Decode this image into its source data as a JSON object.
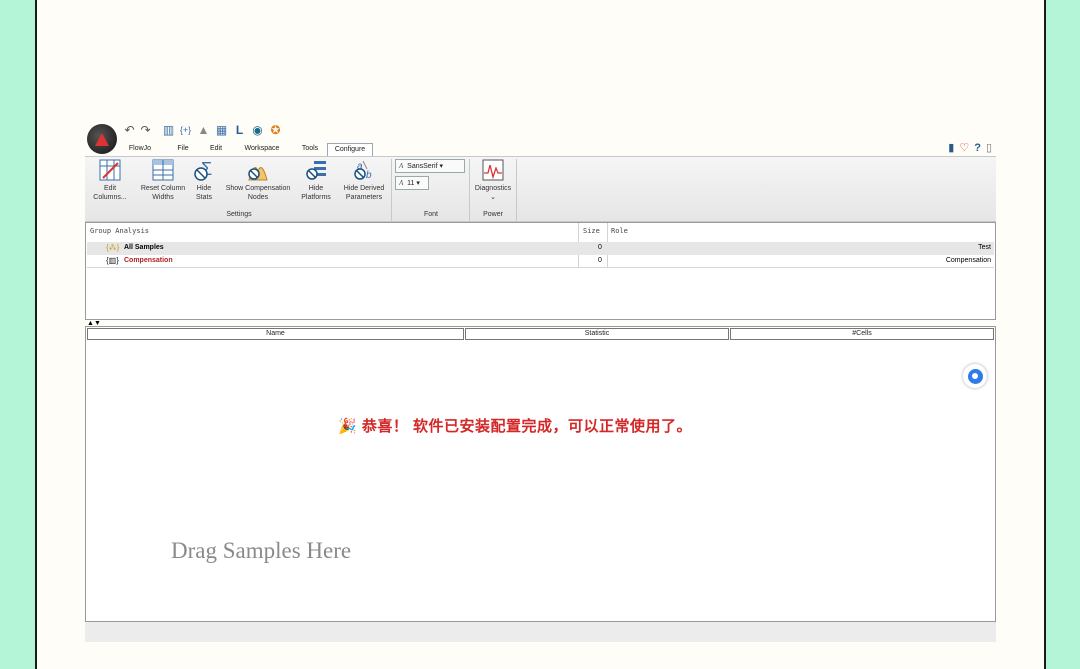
{
  "menu": {
    "tabs": [
      "FlowJo",
      "File",
      "Edit",
      "Workspace",
      "Tools",
      "Configure"
    ],
    "active": "Configure"
  },
  "ribbon": {
    "settings_buttons": [
      {
        "label": "Edit Columns...",
        "line1": "Edit",
        "line2": "Columns..."
      },
      {
        "label": "Reset Column Widths",
        "line1": "Reset Column",
        "line2": "Widths"
      },
      {
        "label": "Hide Stats",
        "line1": "Hide",
        "line2": "Stats"
      },
      {
        "label": "Show Compensation Nodes",
        "line1": "Show Compensation",
        "line2": "Nodes"
      },
      {
        "label": "Hide Platforms",
        "line1": "Hide",
        "line2": "Platforms"
      },
      {
        "label": "Hide Derived Parameters",
        "line1": "Hide Derived",
        "line2": "Parameters"
      }
    ],
    "settings_group": "Settings",
    "font_name": "SansSerif",
    "font_size": "11",
    "font_group": "Font",
    "diagnostics": "Diagnostics",
    "power_group": "Power"
  },
  "group_pane": {
    "headers": {
      "name": "Group Analysis",
      "size": "Size",
      "role": "Role"
    },
    "rows": [
      {
        "name": "All Samples",
        "size": "0",
        "role": "Test"
      },
      {
        "name": "Compensation",
        "size": "0",
        "role": "Compensation"
      }
    ]
  },
  "sample_pane": {
    "columns": [
      "Name",
      "Statistic",
      "#Cells"
    ],
    "message": "恭喜！ 软件已安装配置完成，可以正常使用了。",
    "drop_hint": "Drag Samples Here"
  },
  "colors": {
    "accent": "#d42828",
    "compensation": "#b22222",
    "frame_bg": "#b3f5d6"
  }
}
